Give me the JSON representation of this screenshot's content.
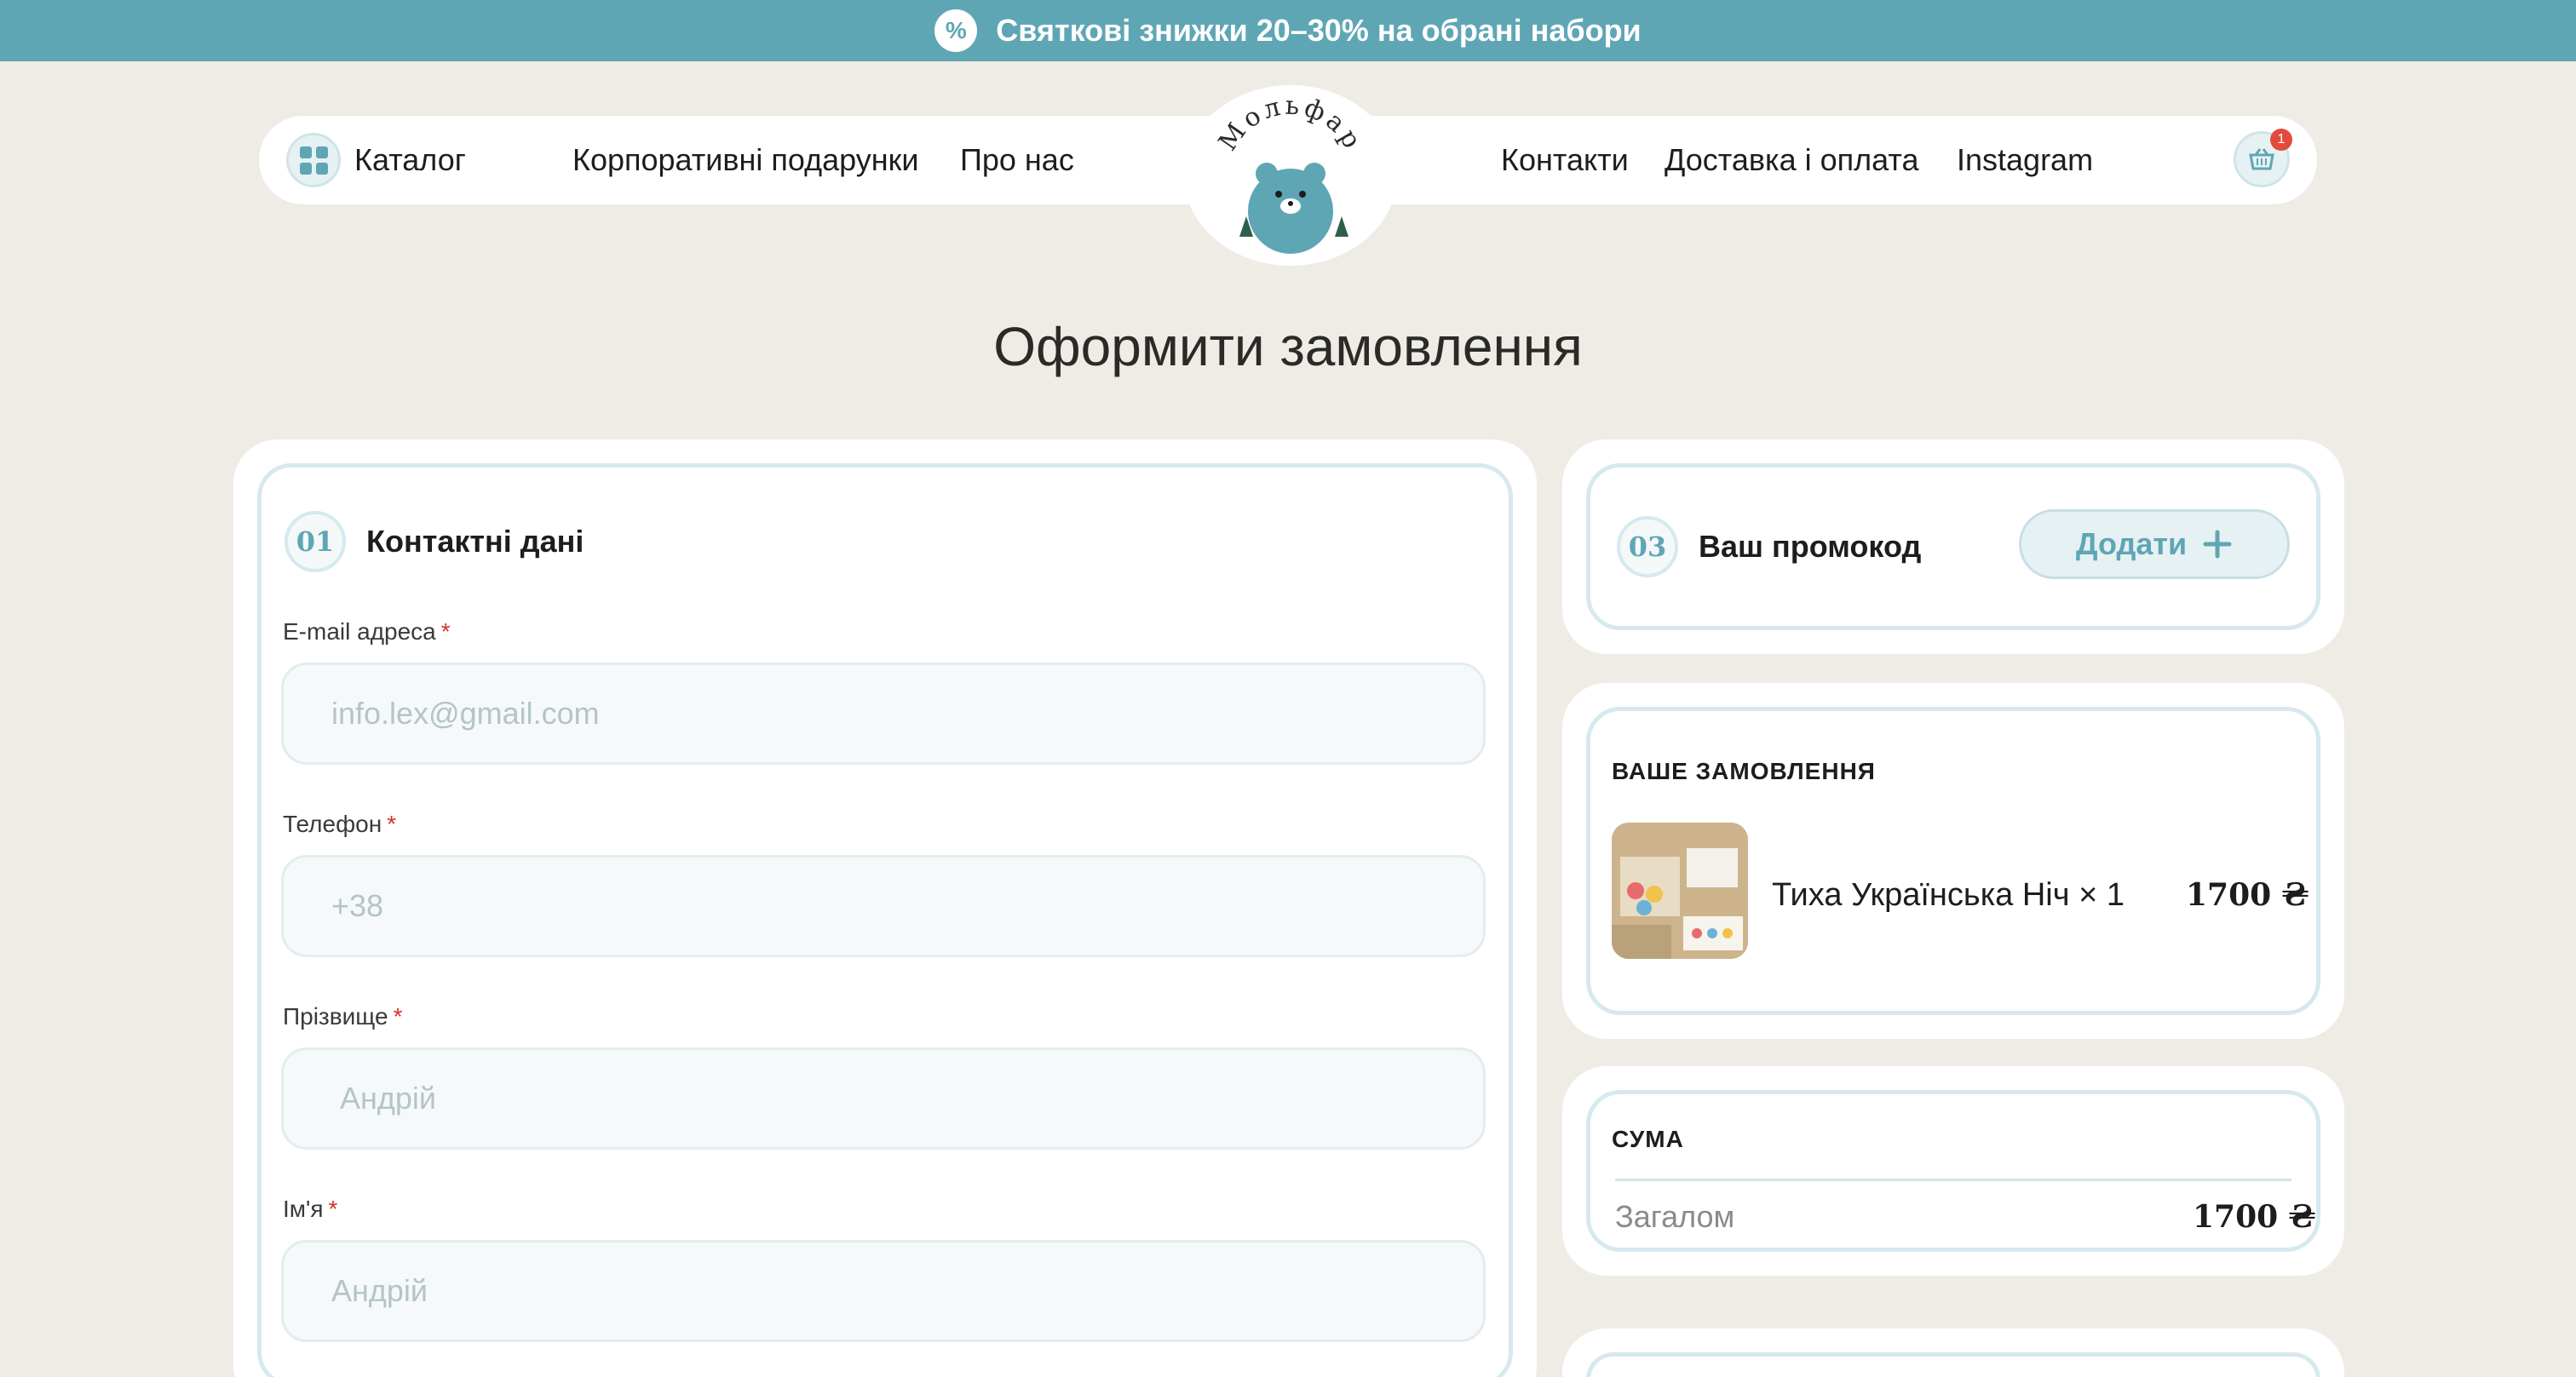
{
  "promo_bar": {
    "icon": "percent-badge-icon",
    "text": "Святкові знижки 20–30% на обрані набори"
  },
  "nav": {
    "catalog": "Каталог",
    "items_left": [
      "Корпоративні подарунки",
      "Про нас"
    ],
    "items_right": [
      "Контакти",
      "Доставка і оплата",
      "Instagram"
    ],
    "logo_text": "Мольфар",
    "cart_count": "1"
  },
  "page_title": "Оформити замовлення",
  "contact": {
    "step": "01",
    "title": "Контактні дані",
    "fields": [
      {
        "label": "E-mail адреса",
        "required": "*",
        "placeholder": "info.lex@gmail.com"
      },
      {
        "label": "Телефон",
        "required": "*",
        "placeholder": "+38"
      },
      {
        "label": "Прізвище",
        "required": "*",
        "placeholder": "Андрій"
      },
      {
        "label": "Ім'я",
        "required": "*",
        "placeholder": "Андрій"
      }
    ]
  },
  "promo": {
    "step": "03",
    "title": "Ваш промокод",
    "add_label": "Додати"
  },
  "order": {
    "title": "ВАШЕ ЗАМОВЛЕННЯ",
    "item_name": "Тиха Українська Ніч × 1",
    "item_price": "1700 ₴"
  },
  "summary": {
    "title": "СУМА",
    "total_label": "Загалом",
    "total_value": "1700 ₴"
  },
  "colors": {
    "accent": "#5fa6b5",
    "background": "#efece6",
    "required": "#d0342c"
  }
}
